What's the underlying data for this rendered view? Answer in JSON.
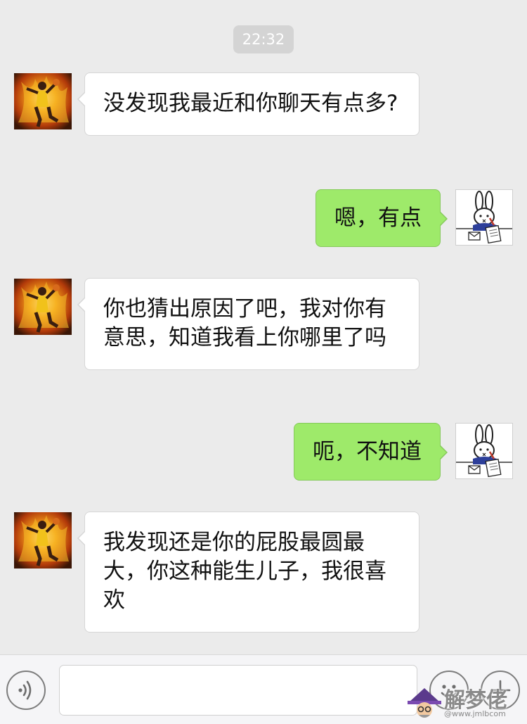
{
  "time": "22:32",
  "messages": [
    {
      "from": "them",
      "text": "没发现我最近和你聊天有点多?"
    },
    {
      "from": "me",
      "text": "嗯，有点"
    },
    {
      "from": "them",
      "text": "你也猜出原因了吧，我对你有意思，知道我看上你哪里了吗"
    },
    {
      "from": "me",
      "text": "呃，不知道"
    },
    {
      "from": "them",
      "text": "我发现还是你的屁股最圆最大，你这种能生儿子，我很喜欢"
    }
  ],
  "input": {
    "value": "",
    "placeholder": ""
  },
  "icons": {
    "voice": "voice-icon",
    "emoji": "emoji-icon",
    "plus": "plus-icon",
    "avatar_them": "basketball-player-flame-avatar",
    "avatar_me": "bunny-writing-avatar"
  },
  "colors": {
    "background": "#ebebeb",
    "incoming_bubble": "#ffffff",
    "outgoing_bubble": "#9eea6a",
    "time_pill": "#d4d4d4"
  },
  "watermark": {
    "text": "解梦佬",
    "sub": "@www.jmlbcom"
  }
}
